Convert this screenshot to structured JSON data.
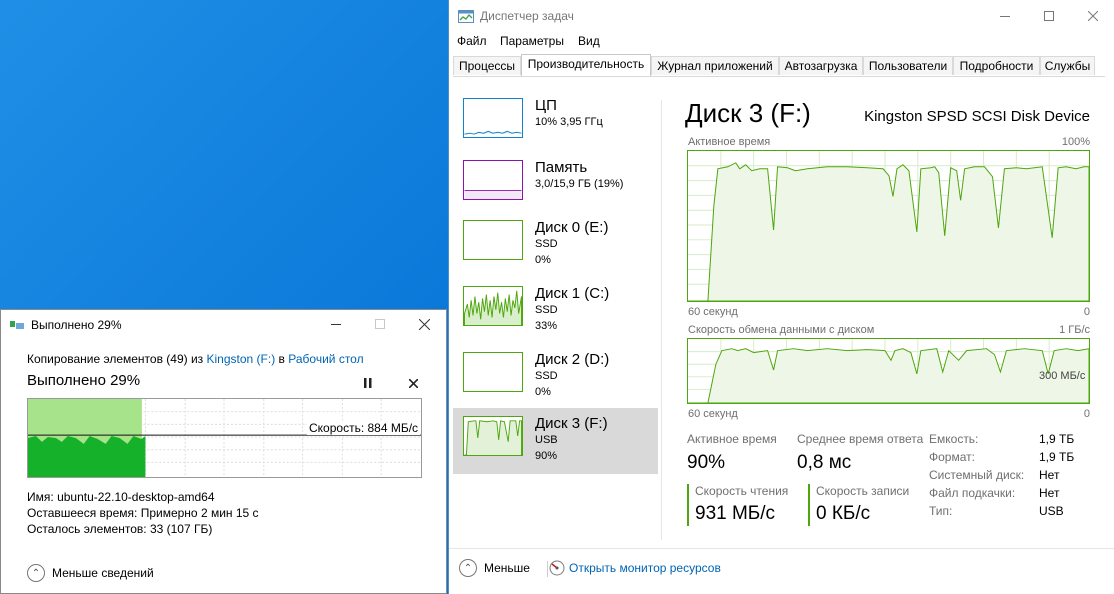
{
  "taskmgr": {
    "title": "Диспетчер задач",
    "menu": [
      "Файл",
      "Параметры",
      "Вид"
    ],
    "tabs": [
      "Процессы",
      "Производительность",
      "Журнал приложений",
      "Автозагрузка",
      "Пользователи",
      "Подробности",
      "Службы"
    ],
    "active_tab": 1,
    "perf_items": [
      {
        "name": "ЦП",
        "line1": "10% 3,95 ГГц",
        "line2": "",
        "color": "#1183c9",
        "level": 0.1
      },
      {
        "name": "Память",
        "line1": "3,0/15,9 ГБ (19%)",
        "line2": "",
        "color": "#8b12ae",
        "level": 0.19
      },
      {
        "name": "Диск 0 (E:)",
        "line1": "SSD",
        "line2": "0%",
        "color": "#4da60c",
        "level": 0
      },
      {
        "name": "Диск 1 (C:)",
        "line1": "SSD",
        "line2": "33%",
        "color": "#4da60c",
        "level": 0.33
      },
      {
        "name": "Диск 2 (D:)",
        "line1": "SSD",
        "line2": "0%",
        "color": "#4da60c",
        "level": 0
      },
      {
        "name": "Диск 3 (F:)",
        "line1": "USB",
        "line2": "90%",
        "color": "#4da60c",
        "level": 0.9
      }
    ],
    "selected_item": 5,
    "disk": {
      "title": "Диск 3 (F:)",
      "model": "Kingston SPSD SCSI Disk Device",
      "active_time_graph": {
        "label": "Активное время",
        "max": "100%",
        "time": "60 секунд",
        "min": "0"
      },
      "transfer_graph": {
        "label": "Скорость обмена данными с диском",
        "max": "1 ГБ/с",
        "time": "60 секунд",
        "min": "0",
        "mid_label": "300 МБ/с"
      },
      "stats": {
        "active_time_label": "Активное время",
        "active_time_value": "90%",
        "response_label": "Среднее время ответа",
        "response_value": "0,8 мс",
        "read_label": "Скорость чтения",
        "read_value": "931 МБ/с",
        "write_label": "Скорость записи",
        "write_value": "0 КБ/с"
      },
      "props": [
        {
          "k": "Емкость:",
          "v": "1,9 ТБ"
        },
        {
          "k": "Формат:",
          "v": "1,9 ТБ"
        },
        {
          "k": "Системный диск:",
          "v": "Нет"
        },
        {
          "k": "Файл подкачки:",
          "v": "Нет"
        },
        {
          "k": "Тип:",
          "v": "USB"
        }
      ]
    },
    "footer": {
      "less_label": "Меньше",
      "resmon_label": "Открыть монитор ресурсов"
    },
    "colors": {
      "disk": "#4da60c",
      "disk_fill": "#eef6e7",
      "link": "#0064b4"
    }
  },
  "copy": {
    "title": "Выполнено 29%",
    "line_prefix": "Копирование элементов (49) из ",
    "source": "Kingston (F:)",
    "line_mid": " в ",
    "dest": "Рабочий стол",
    "big_status": "Выполнено 29%",
    "progress": 0.29,
    "speed_label": "Скорость: 884 МБ/с",
    "name_label": "Имя:",
    "name_value": "ubuntu-22.10-desktop-amd64",
    "remaining_label": "Оставшееся время:",
    "remaining_value": "Примерно 2 мин 15 с",
    "items_label": "Осталось элементов:",
    "items_value": "33 (107 ГБ)",
    "less_label": "Меньше сведений",
    "colors": {
      "fill_light": "#a6e38a",
      "fill_dark": "#16b12b"
    }
  }
}
